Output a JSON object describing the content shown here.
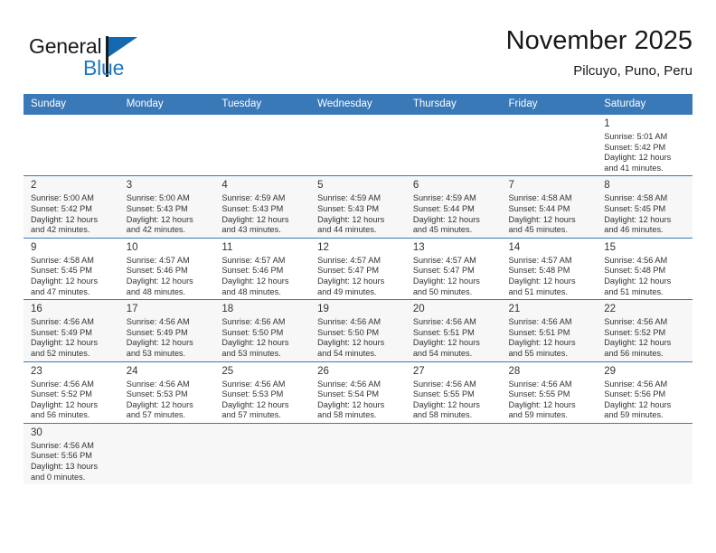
{
  "brand": {
    "name_part1": "General",
    "name_part2": "Blue",
    "flag_icon": "blue-triangle-flag-icon"
  },
  "header": {
    "month_title": "November 2025",
    "location": "Pilcuyo, Puno, Peru"
  },
  "colors": {
    "header_blue": "#3a79b8",
    "brand_blue": "#1f77c2",
    "row_alt": "#f7f7f7",
    "text": "#333333"
  },
  "weekday_headers": [
    "Sunday",
    "Monday",
    "Tuesday",
    "Wednesday",
    "Thursday",
    "Friday",
    "Saturday"
  ],
  "weeks": [
    [
      {
        "day": "",
        "empty": true
      },
      {
        "day": "",
        "empty": true
      },
      {
        "day": "",
        "empty": true
      },
      {
        "day": "",
        "empty": true
      },
      {
        "day": "",
        "empty": true
      },
      {
        "day": "",
        "empty": true
      },
      {
        "day": "1",
        "sunrise": "Sunrise: 5:01 AM",
        "sunset": "Sunset: 5:42 PM",
        "daylight_line1": "Daylight: 12 hours",
        "daylight_line2": "and 41 minutes."
      }
    ],
    [
      {
        "day": "2",
        "sunrise": "Sunrise: 5:00 AM",
        "sunset": "Sunset: 5:42 PM",
        "daylight_line1": "Daylight: 12 hours",
        "daylight_line2": "and 42 minutes."
      },
      {
        "day": "3",
        "sunrise": "Sunrise: 5:00 AM",
        "sunset": "Sunset: 5:43 PM",
        "daylight_line1": "Daylight: 12 hours",
        "daylight_line2": "and 42 minutes."
      },
      {
        "day": "4",
        "sunrise": "Sunrise: 4:59 AM",
        "sunset": "Sunset: 5:43 PM",
        "daylight_line1": "Daylight: 12 hours",
        "daylight_line2": "and 43 minutes."
      },
      {
        "day": "5",
        "sunrise": "Sunrise: 4:59 AM",
        "sunset": "Sunset: 5:43 PM",
        "daylight_line1": "Daylight: 12 hours",
        "daylight_line2": "and 44 minutes."
      },
      {
        "day": "6",
        "sunrise": "Sunrise: 4:59 AM",
        "sunset": "Sunset: 5:44 PM",
        "daylight_line1": "Daylight: 12 hours",
        "daylight_line2": "and 45 minutes."
      },
      {
        "day": "7",
        "sunrise": "Sunrise: 4:58 AM",
        "sunset": "Sunset: 5:44 PM",
        "daylight_line1": "Daylight: 12 hours",
        "daylight_line2": "and 45 minutes."
      },
      {
        "day": "8",
        "sunrise": "Sunrise: 4:58 AM",
        "sunset": "Sunset: 5:45 PM",
        "daylight_line1": "Daylight: 12 hours",
        "daylight_line2": "and 46 minutes."
      }
    ],
    [
      {
        "day": "9",
        "sunrise": "Sunrise: 4:58 AM",
        "sunset": "Sunset: 5:45 PM",
        "daylight_line1": "Daylight: 12 hours",
        "daylight_line2": "and 47 minutes."
      },
      {
        "day": "10",
        "sunrise": "Sunrise: 4:57 AM",
        "sunset": "Sunset: 5:46 PM",
        "daylight_line1": "Daylight: 12 hours",
        "daylight_line2": "and 48 minutes."
      },
      {
        "day": "11",
        "sunrise": "Sunrise: 4:57 AM",
        "sunset": "Sunset: 5:46 PM",
        "daylight_line1": "Daylight: 12 hours",
        "daylight_line2": "and 48 minutes."
      },
      {
        "day": "12",
        "sunrise": "Sunrise: 4:57 AM",
        "sunset": "Sunset: 5:47 PM",
        "daylight_line1": "Daylight: 12 hours",
        "daylight_line2": "and 49 minutes."
      },
      {
        "day": "13",
        "sunrise": "Sunrise: 4:57 AM",
        "sunset": "Sunset: 5:47 PM",
        "daylight_line1": "Daylight: 12 hours",
        "daylight_line2": "and 50 minutes."
      },
      {
        "day": "14",
        "sunrise": "Sunrise: 4:57 AM",
        "sunset": "Sunset: 5:48 PM",
        "daylight_line1": "Daylight: 12 hours",
        "daylight_line2": "and 51 minutes."
      },
      {
        "day": "15",
        "sunrise": "Sunrise: 4:56 AM",
        "sunset": "Sunset: 5:48 PM",
        "daylight_line1": "Daylight: 12 hours",
        "daylight_line2": "and 51 minutes."
      }
    ],
    [
      {
        "day": "16",
        "sunrise": "Sunrise: 4:56 AM",
        "sunset": "Sunset: 5:49 PM",
        "daylight_line1": "Daylight: 12 hours",
        "daylight_line2": "and 52 minutes."
      },
      {
        "day": "17",
        "sunrise": "Sunrise: 4:56 AM",
        "sunset": "Sunset: 5:49 PM",
        "daylight_line1": "Daylight: 12 hours",
        "daylight_line2": "and 53 minutes."
      },
      {
        "day": "18",
        "sunrise": "Sunrise: 4:56 AM",
        "sunset": "Sunset: 5:50 PM",
        "daylight_line1": "Daylight: 12 hours",
        "daylight_line2": "and 53 minutes."
      },
      {
        "day": "19",
        "sunrise": "Sunrise: 4:56 AM",
        "sunset": "Sunset: 5:50 PM",
        "daylight_line1": "Daylight: 12 hours",
        "daylight_line2": "and 54 minutes."
      },
      {
        "day": "20",
        "sunrise": "Sunrise: 4:56 AM",
        "sunset": "Sunset: 5:51 PM",
        "daylight_line1": "Daylight: 12 hours",
        "daylight_line2": "and 54 minutes."
      },
      {
        "day": "21",
        "sunrise": "Sunrise: 4:56 AM",
        "sunset": "Sunset: 5:51 PM",
        "daylight_line1": "Daylight: 12 hours",
        "daylight_line2": "and 55 minutes."
      },
      {
        "day": "22",
        "sunrise": "Sunrise: 4:56 AM",
        "sunset": "Sunset: 5:52 PM",
        "daylight_line1": "Daylight: 12 hours",
        "daylight_line2": "and 56 minutes."
      }
    ],
    [
      {
        "day": "23",
        "sunrise": "Sunrise: 4:56 AM",
        "sunset": "Sunset: 5:52 PM",
        "daylight_line1": "Daylight: 12 hours",
        "daylight_line2": "and 56 minutes."
      },
      {
        "day": "24",
        "sunrise": "Sunrise: 4:56 AM",
        "sunset": "Sunset: 5:53 PM",
        "daylight_line1": "Daylight: 12 hours",
        "daylight_line2": "and 57 minutes."
      },
      {
        "day": "25",
        "sunrise": "Sunrise: 4:56 AM",
        "sunset": "Sunset: 5:53 PM",
        "daylight_line1": "Daylight: 12 hours",
        "daylight_line2": "and 57 minutes."
      },
      {
        "day": "26",
        "sunrise": "Sunrise: 4:56 AM",
        "sunset": "Sunset: 5:54 PM",
        "daylight_line1": "Daylight: 12 hours",
        "daylight_line2": "and 58 minutes."
      },
      {
        "day": "27",
        "sunrise": "Sunrise: 4:56 AM",
        "sunset": "Sunset: 5:55 PM",
        "daylight_line1": "Daylight: 12 hours",
        "daylight_line2": "and 58 minutes."
      },
      {
        "day": "28",
        "sunrise": "Sunrise: 4:56 AM",
        "sunset": "Sunset: 5:55 PM",
        "daylight_line1": "Daylight: 12 hours",
        "daylight_line2": "and 59 minutes."
      },
      {
        "day": "29",
        "sunrise": "Sunrise: 4:56 AM",
        "sunset": "Sunset: 5:56 PM",
        "daylight_line1": "Daylight: 12 hours",
        "daylight_line2": "and 59 minutes."
      }
    ],
    [
      {
        "day": "30",
        "sunrise": "Sunrise: 4:56 AM",
        "sunset": "Sunset: 5:56 PM",
        "daylight_line1": "Daylight: 13 hours",
        "daylight_line2": "and 0 minutes."
      },
      {
        "day": "",
        "empty": true
      },
      {
        "day": "",
        "empty": true
      },
      {
        "day": "",
        "empty": true
      },
      {
        "day": "",
        "empty": true
      },
      {
        "day": "",
        "empty": true
      },
      {
        "day": "",
        "empty": true
      }
    ]
  ]
}
